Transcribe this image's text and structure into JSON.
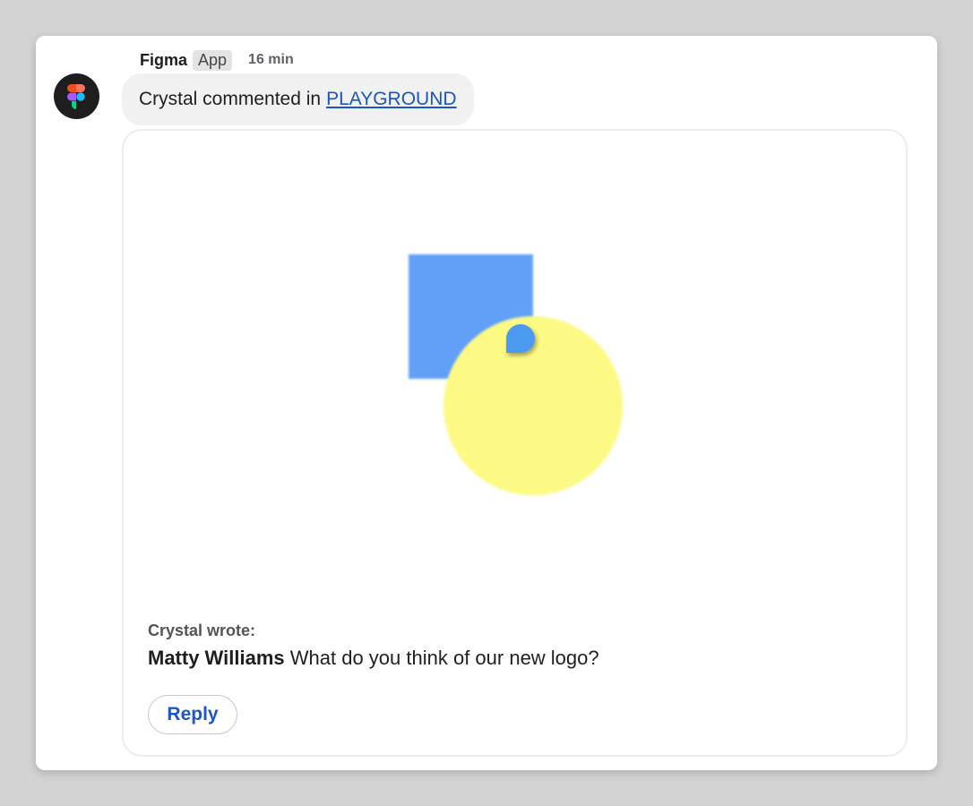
{
  "message": {
    "sender": "Figma",
    "badge": "App",
    "time": "16 min",
    "avatar_icon": "figma-logo-icon",
    "text_prefix": "Crystal commented in",
    "link_text": "PLAYGROUND"
  },
  "attachment": {
    "wrote_label": "Crystal wrote:",
    "comment_author": "Matty Williams",
    "comment_text": "What do you think of our new logo?",
    "reply_label": "Reply",
    "preview": {
      "square_color": "#62a0f7",
      "circle_color": "#fdf985",
      "pin_color": "#4a9af0",
      "pin_icon": "comment-pin-icon"
    }
  },
  "colors": {
    "link": "#1a56c7",
    "background": "#d3d3d3"
  }
}
